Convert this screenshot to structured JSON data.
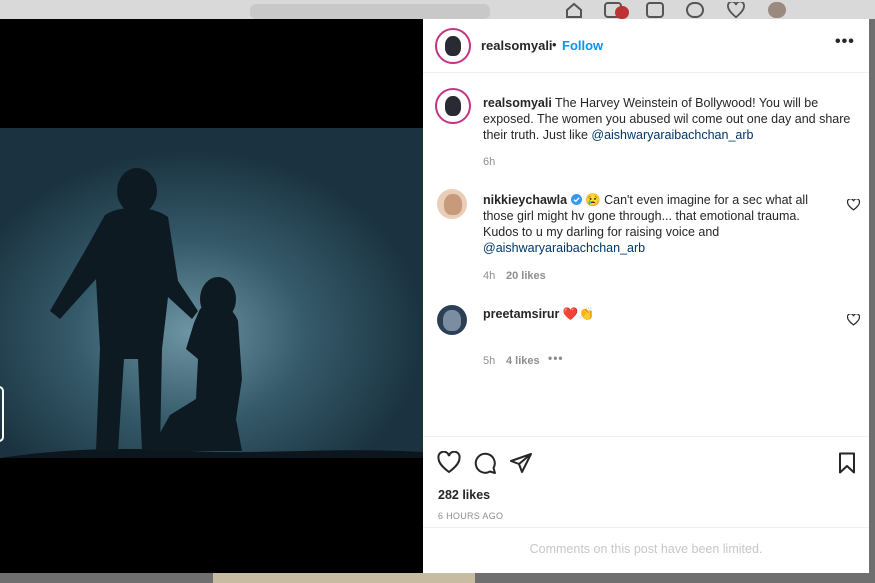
{
  "post": {
    "author": "realsomyali",
    "separator": "•",
    "follow_label": "Follow",
    "more_label": "•••"
  },
  "caption": {
    "username": "realsomyali",
    "text": "The Harvey Weinstein of Bollywood! You will be exposed. The women you abused wil come out one day and share their truth. Just like",
    "mention": "@aishwaryaraibachchan_arb",
    "time": "6h"
  },
  "comments": [
    {
      "username": "nikkieychawla",
      "verified": true,
      "emoji": "😢",
      "text": "Can't even imagine for a sec what all those girl might hv gone through... that emotional trauma. Kudos to u my darling for raising voice and",
      "mention": "@aishwaryaraibachchan_arb",
      "time": "4h",
      "likes": "20 likes"
    },
    {
      "username": "preetamsirur",
      "emoji": "❤️👏",
      "time": "5h",
      "likes": "4 likes",
      "more": "•••"
    }
  ],
  "actions": {
    "icons": [
      "heart-icon",
      "comment-icon",
      "share-icon",
      "bookmark-icon"
    ],
    "likes": "282 likes",
    "timestamp": "6 HOURS AGO"
  },
  "footer": {
    "limited_text": "Comments on this post have been limited."
  },
  "colors": {
    "accent": "#0095f6",
    "text": "#262626",
    "muted": "#8e8e8e",
    "border": "#efefef"
  }
}
